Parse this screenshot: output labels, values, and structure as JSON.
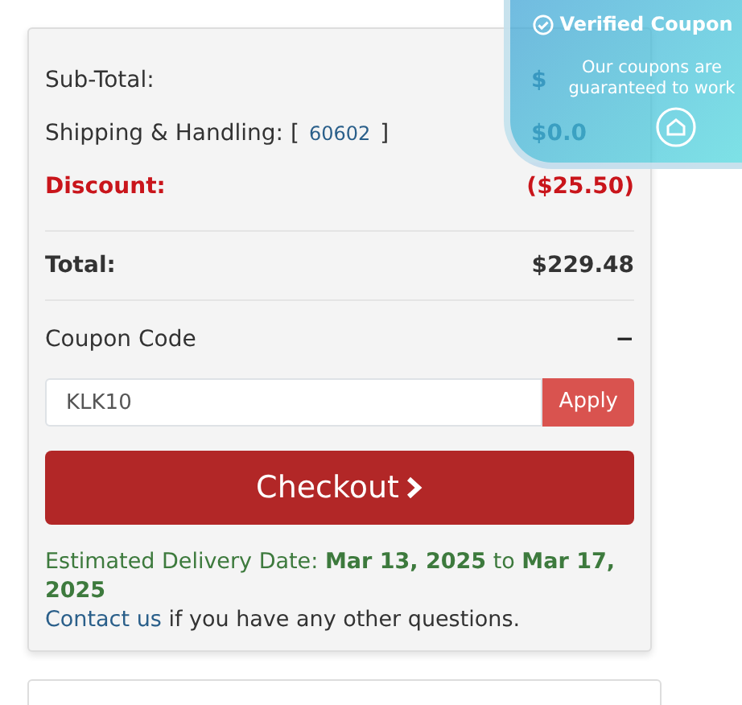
{
  "summary": [
    {
      "kind": "plain",
      "label": "Sub-Total:",
      "value": "$"
    },
    {
      "kind": "shipping",
      "label": "Shipping & Handling: [",
      "zip": "60602",
      "label_end": "]",
      "value": "$0.0"
    },
    {
      "kind": "discount",
      "label": "Discount:",
      "value": "($25.50)"
    },
    {
      "kind": "total",
      "label": "Total:",
      "value": "$229.48"
    }
  ],
  "coupon": {
    "title": "Coupon Code",
    "expanded": true,
    "toggle": "−",
    "value": "KLK10",
    "button": "Apply"
  },
  "checkout": {
    "label": "Checkout"
  },
  "delivery": {
    "text": "Estimated Delivery Date: **Mar 13, 2025** to **Mar 17, 2025**"
  },
  "contact": {
    "link": "Contact us",
    "text": "if you have any other questions."
  },
  "badge": {
    "title": "Verified Coupon",
    "text": "Our coupons are guaranteed to work"
  }
}
